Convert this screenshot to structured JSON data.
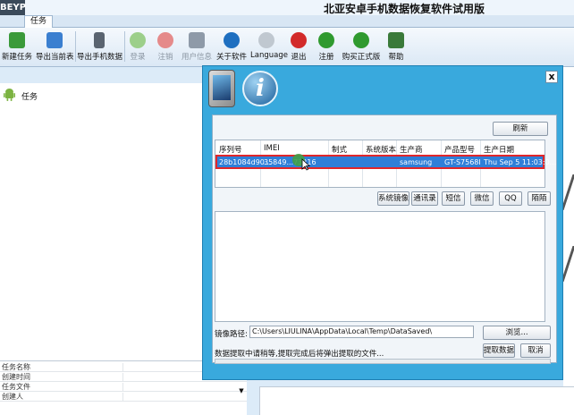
{
  "app": {
    "logo": "BEYP",
    "title": "北亚安卓手机数据恢复软件试用版",
    "tab_task": "任务"
  },
  "ribbon": {
    "items": [
      {
        "label": "新建任务",
        "icon": "new-task-icon",
        "color": "#3a9a3a",
        "enabled": true
      },
      {
        "label": "导出当前表",
        "icon": "export-table-icon",
        "color": "#3a7fd0",
        "enabled": true
      },
      {
        "label": "导出手机数据",
        "icon": "export-phone-icon",
        "color": "#5a6470",
        "enabled": true
      },
      {
        "label": "登录",
        "icon": "login-icon",
        "color": "#9ccf8a",
        "enabled": false
      },
      {
        "label": "注销",
        "icon": "logout-icon",
        "color": "#e58a8a",
        "enabled": false
      },
      {
        "label": "用户信息",
        "icon": "user-info-icon",
        "color": "#8e9aa8",
        "enabled": false
      },
      {
        "label": "关于软件",
        "icon": "about-icon",
        "color": "#1e6fc0",
        "enabled": true
      },
      {
        "label": "Language",
        "icon": "language-icon",
        "color": "#c0c8d0",
        "enabled": true
      },
      {
        "label": "退出",
        "icon": "exit-icon",
        "color": "#d22a2a",
        "enabled": true
      },
      {
        "label": "注册",
        "icon": "register-icon",
        "color": "#2f9a2f",
        "enabled": true
      },
      {
        "label": "购买正式版",
        "icon": "buy-icon",
        "color": "#2f9a2f",
        "enabled": true
      },
      {
        "label": "帮助",
        "icon": "help-icon",
        "color": "#3a7a3a",
        "enabled": true
      }
    ]
  },
  "left_pane": {
    "tree_item": "任务",
    "tree_icon": "android-icon",
    "props": [
      "任务名称",
      "创建时间",
      "任务文件",
      "创建人"
    ]
  },
  "dialog": {
    "close": "x",
    "refresh_label": "刷新",
    "columns": [
      "序列号",
      "IMEI",
      "制式",
      "系统版本",
      "生产商",
      "产品型号",
      "生产日期"
    ],
    "row": [
      "28b1084d90...",
      "35849...73216",
      "",
      "",
      "samsung",
      "GT-S7568I",
      "Thu Sep  5 11:03:0..."
    ],
    "action_buttons": [
      "系统镜像",
      "通讯录",
      "短信",
      "微信",
      "QQ",
      "陌陌"
    ],
    "path_label": "镜像路径:",
    "path_value": "C:\\Users\\LIULINA\\AppData\\Local\\Temp\\DataSaved\\",
    "browse_label": "浏览...",
    "status_text": "数据提取中请稍等,提取完成后将弹出提取的文件...",
    "extract_label": "提取数据",
    "cancel_label": "取消"
  }
}
